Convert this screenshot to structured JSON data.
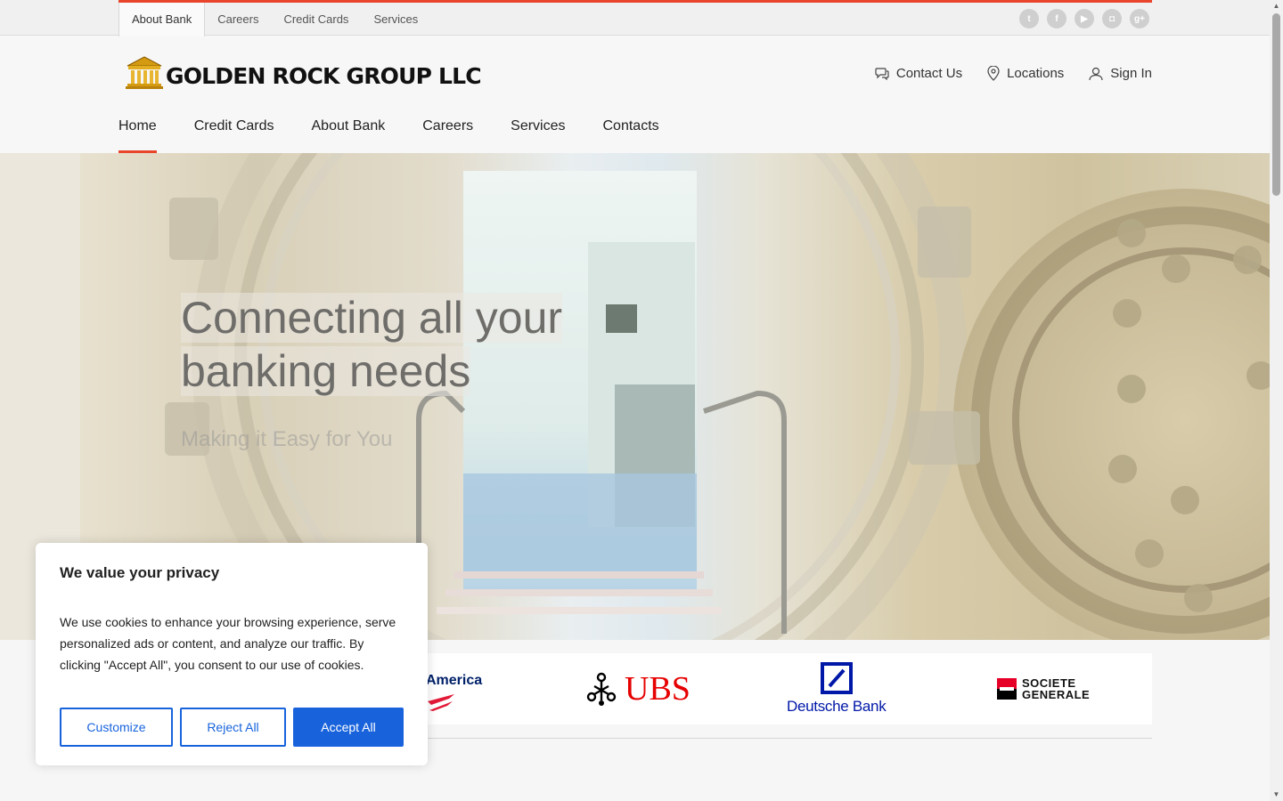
{
  "topbar": {
    "links": [
      "About Bank",
      "Careers",
      "Credit Cards",
      "Services"
    ],
    "active_index": 0,
    "social_icons": [
      "twitter-icon",
      "facebook-icon",
      "youtube-icon",
      "instagram-icon",
      "google-plus-icon"
    ],
    "accent": "#e8452c"
  },
  "header": {
    "logo_text": "GOLDEN ROCK GROUP LLC",
    "contact_label": "Contact Us",
    "locations_label": "Locations",
    "signin_label": "Sign In"
  },
  "nav": {
    "items": [
      "Home",
      "Credit Cards",
      "About Bank",
      "Careers",
      "Services",
      "Contacts"
    ],
    "active_index": 0
  },
  "hero": {
    "title_line1": "Connecting all your",
    "title_line2": "banking needs",
    "subtitle": "Making it Easy for You"
  },
  "partners": {
    "bofa_text": "America",
    "ubs_text": "UBS",
    "deutsche_text": "Deutsche Bank",
    "socgen_line1": "SOCIETE",
    "socgen_line2": "GENERALE"
  },
  "cookie": {
    "title": "We value your privacy",
    "text": "We use cookies to enhance your browsing experience, serve personalized ads or content, and analyze our traffic. By clicking \"Accept All\", you consent to our use of cookies.",
    "customize_label": "Customize",
    "reject_label": "Reject All",
    "accept_label": "Accept All",
    "button_color": "#1863dc"
  }
}
